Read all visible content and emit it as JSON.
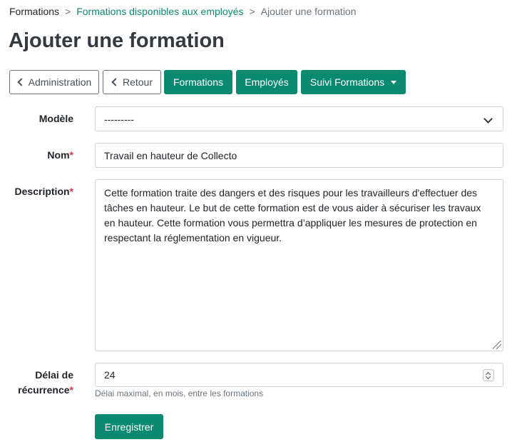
{
  "breadcrumb": {
    "root": "Formations",
    "separator": ">",
    "link": "Formations disponibles aux employés",
    "current": "Ajouter une formation"
  },
  "page": {
    "title": "Ajouter une formation"
  },
  "toolbar": {
    "administration_label": "Administration",
    "retour_label": "Retour",
    "formations_label": "Formations",
    "employes_label": "Employés",
    "suivi_label": "Suivi Formations"
  },
  "form": {
    "modele": {
      "label": "Modèle",
      "value": "---------"
    },
    "nom": {
      "label": "Nom",
      "required_mark": "*",
      "value": "Travail en hauteur de Collecto"
    },
    "description": {
      "label": "Description",
      "required_mark": "*",
      "value": "Cette formation traite des dangers et des risques pour les travailleurs d'effectuer des tâches en hauteur. Le but de cette formation est de vous aider à sécuriser les travaux en hauteur. Cette formation vous permettra d’appliquer les mesures de protection en respectant la réglementation en vigueur."
    },
    "delai": {
      "label_line1": "Délai de",
      "label_line2": "récurrence",
      "required_mark": "*",
      "value": "24",
      "help": "Délai maximal, en mois, entre les formations"
    },
    "submit_label": "Enregistrer"
  },
  "colors": {
    "accent": "#0b8a6f",
    "required": "#dc3545",
    "muted": "#6c757d"
  }
}
